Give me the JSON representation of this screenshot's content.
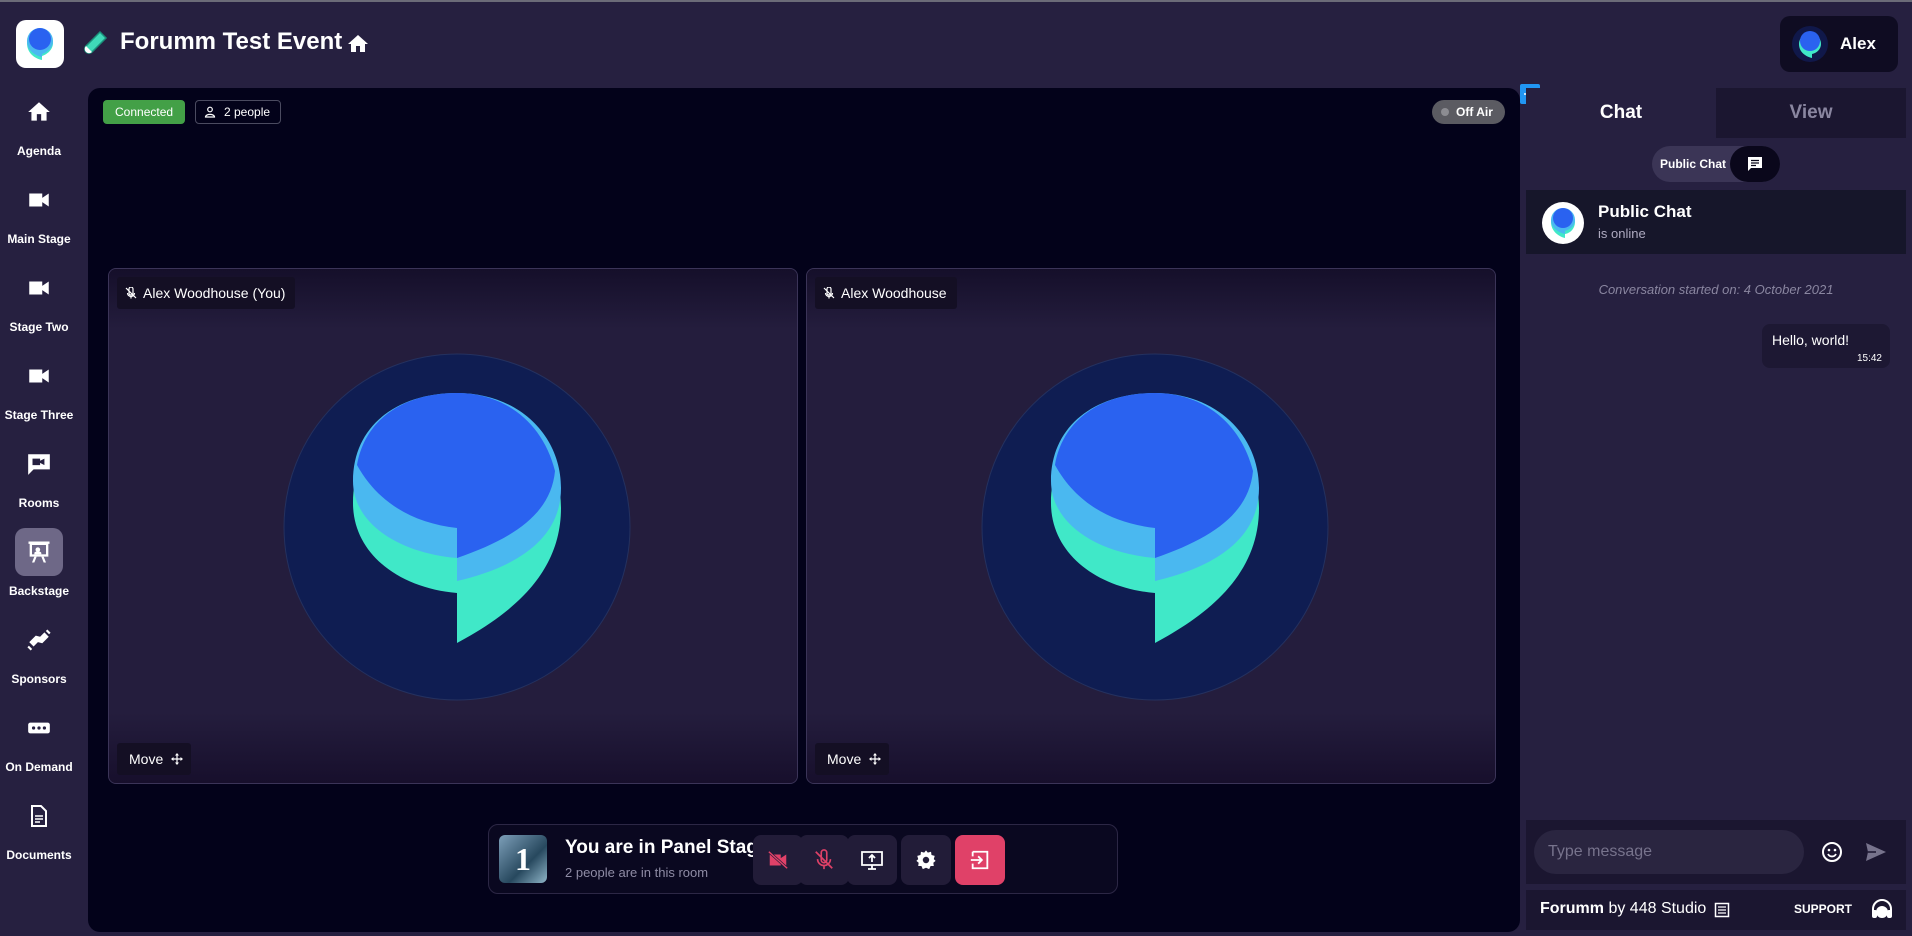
{
  "header": {
    "event_title": "Forumm Test Event",
    "user_name": "Alex"
  },
  "sidebar": {
    "items": [
      {
        "label": "Agenda",
        "icon": "home-icon"
      },
      {
        "label": "Main Stage",
        "icon": "video-icon"
      },
      {
        "label": "Stage Two",
        "icon": "video-icon"
      },
      {
        "label": "Stage Three",
        "icon": "video-icon"
      },
      {
        "label": "Rooms",
        "icon": "chat-video-icon"
      },
      {
        "label": "Backstage",
        "icon": "presentation-icon",
        "active": true
      },
      {
        "label": "Sponsors",
        "icon": "handshake-icon"
      },
      {
        "label": "On Demand",
        "icon": "ellipsis-box-icon"
      },
      {
        "label": "Documents",
        "icon": "document-icon"
      }
    ]
  },
  "stage": {
    "status": "Connected",
    "people": "2 people",
    "broadcast": "Off Air",
    "tiles": [
      {
        "name": "Alex Woodhouse (You)",
        "move_label": "Move",
        "muted": true
      },
      {
        "name": "Alex Woodhouse",
        "move_label": "Move",
        "muted": true
      }
    ],
    "room": {
      "thumb_number": "1",
      "title": "You are in Panel Stage 1",
      "subtitle": "2 people are in this room"
    }
  },
  "chat": {
    "tabs": [
      "Chat",
      "View"
    ],
    "active_tab": "Chat",
    "channel_pill": "Public Chat",
    "room_name": "Public Chat",
    "room_status": "is online",
    "conversation_started": "Conversation started on: 4 October 2021",
    "messages": [
      {
        "text": "Hello, world!",
        "time": "15:42"
      }
    ],
    "input_placeholder": "Type message"
  },
  "footer": {
    "brand": "Forumm",
    "by": "by 448 Studio",
    "support": "SUPPORT"
  },
  "colors": {
    "background": "#262040",
    "stage": "#03021a",
    "connected": "#43a047",
    "leave": "#e04168",
    "muted_icon": "#e04168",
    "accent": "#2196f3"
  }
}
